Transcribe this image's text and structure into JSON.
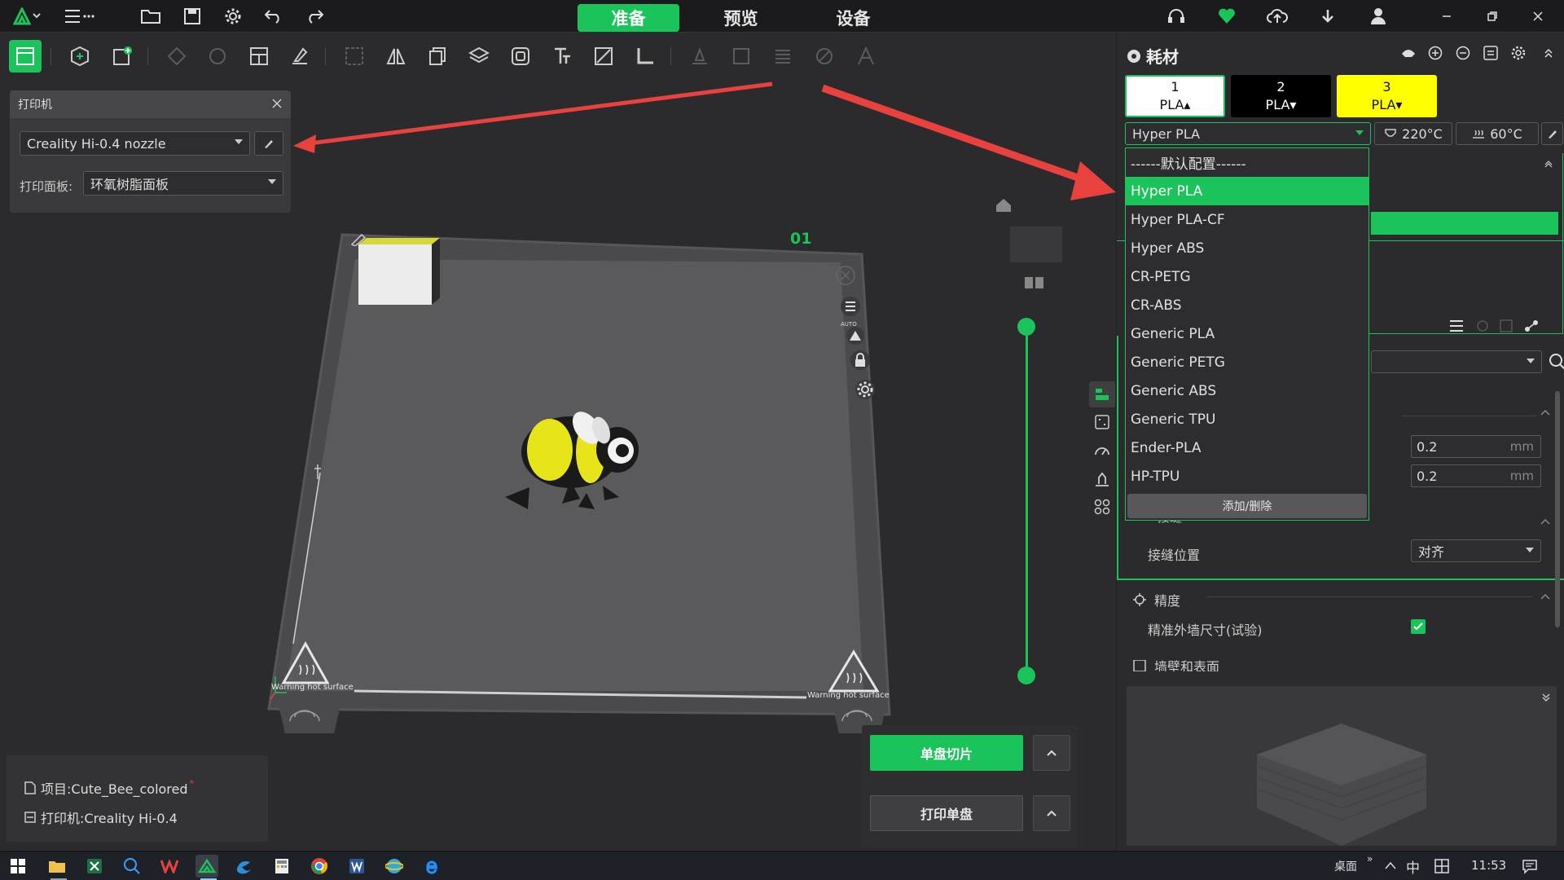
{
  "top_tabs": [
    "准备",
    "预览",
    "设备"
  ],
  "printer_panel": {
    "title": "打印机",
    "printer_select": "Creality Hi-0.4 nozzle",
    "plate_label": "打印面板:",
    "plate_select": "环氧树脂面板"
  },
  "scene": {
    "plate_number": "01",
    "auto_label": "AUTO",
    "warning_left": "Warning hot surface",
    "warning_right": "Warning hot surface"
  },
  "buttons": {
    "slice_label": "单盘切片",
    "print_label": "打印单盘"
  },
  "project": {
    "project_name": "项目:Cute_Bee_colored",
    "modified_mark": "*",
    "printer_name": "打印机:Creality Hi-0.4"
  },
  "filament": {
    "title": "耗材",
    "slots": [
      {
        "num": "1",
        "label": "PLA▴",
        "color": "#ffffff"
      },
      {
        "num": "2",
        "label": "PLA▾",
        "color": "#000000"
      },
      {
        "num": "3",
        "label": "PLA▾",
        "color": "#ffff00"
      }
    ],
    "selected": "Hyper PLA",
    "nozzle_temp": "220°C",
    "bed_temp": "60°C",
    "dropdown_options": [
      "------默认配置------",
      "Hyper PLA",
      "Hyper PLA-CF",
      "Hyper ABS",
      "CR-PETG",
      "CR-ABS",
      "Generic PLA",
      "Generic PETG",
      "Generic ABS",
      "Generic TPU",
      "Ender-PLA",
      "HP-TPU"
    ],
    "add_remove": "添加/删除"
  },
  "process": {
    "layer_height": "0.2",
    "first_layer_height": "0.2",
    "unit": "mm",
    "seam_section": "接缝",
    "seam_position_label": "接缝位置",
    "seam_position_value": "对齐",
    "precision_section": "精度",
    "precise_wall_label": "精准外墙尺寸(试验)",
    "precise_wall_checked": true,
    "wall_section": "墙壁和表面"
  },
  "taskbar": {
    "desktop": "桌面",
    "ime": "中",
    "time": "11:53"
  },
  "colors": {
    "accent": "#1bc45a",
    "arrow": "#e8413e"
  }
}
